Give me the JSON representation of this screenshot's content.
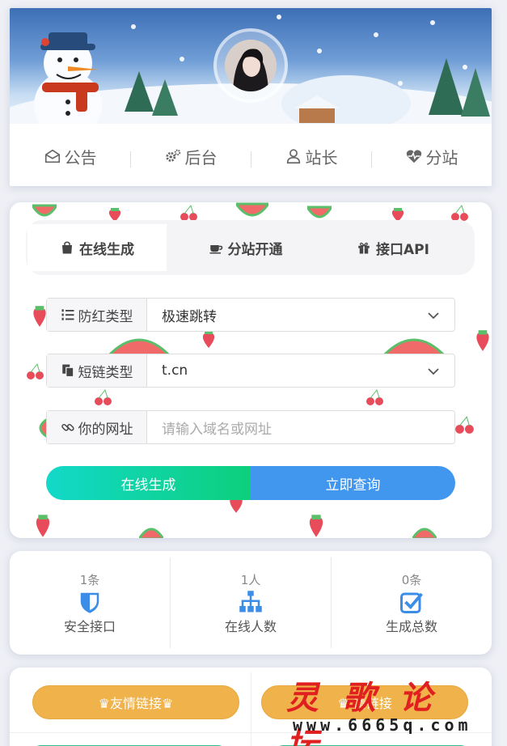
{
  "nav": {
    "items": [
      {
        "label": "公告",
        "icon": "envelope-open-icon"
      },
      {
        "label": "后台",
        "icon": "gears-icon"
      },
      {
        "label": "站长",
        "icon": "user-icon"
      },
      {
        "label": "分站",
        "icon": "heartbeat-icon"
      }
    ]
  },
  "tabs": [
    {
      "label": "在线生成",
      "icon": "shopping-bag-icon",
      "active": true
    },
    {
      "label": "分站开通",
      "icon": "coffee-icon",
      "active": false
    },
    {
      "label": "接口API",
      "icon": "gift-icon",
      "active": false
    }
  ],
  "form": {
    "antired": {
      "label": "防红类型",
      "value": "极速跳转"
    },
    "shortlink": {
      "label": "短链类型",
      "value": "t.cn"
    },
    "url": {
      "label": "你的网址",
      "placeholder": "请输入域名或网址"
    },
    "generate_label": "在线生成",
    "query_label": "立即查询"
  },
  "stats": [
    {
      "value": "1条",
      "label": "安全接口",
      "icon": "shield-icon"
    },
    {
      "value": "1人",
      "label": "在线人数",
      "icon": "sitemap-icon"
    },
    {
      "value": "0条",
      "label": "生成总数",
      "icon": "check-square-icon"
    }
  ],
  "links": {
    "friend_label": "♛友情链接♛",
    "partial_label": "♛ 情链接"
  },
  "watermark": {
    "title": "灵歌论坛",
    "url": "www.6665q.com"
  },
  "colors": {
    "generate_gradient": [
      "#12d9c9",
      "#0dcf7c"
    ],
    "query": "#4196ee",
    "link_button": "#f0b24a",
    "stat_icon": "#3b8de8"
  }
}
